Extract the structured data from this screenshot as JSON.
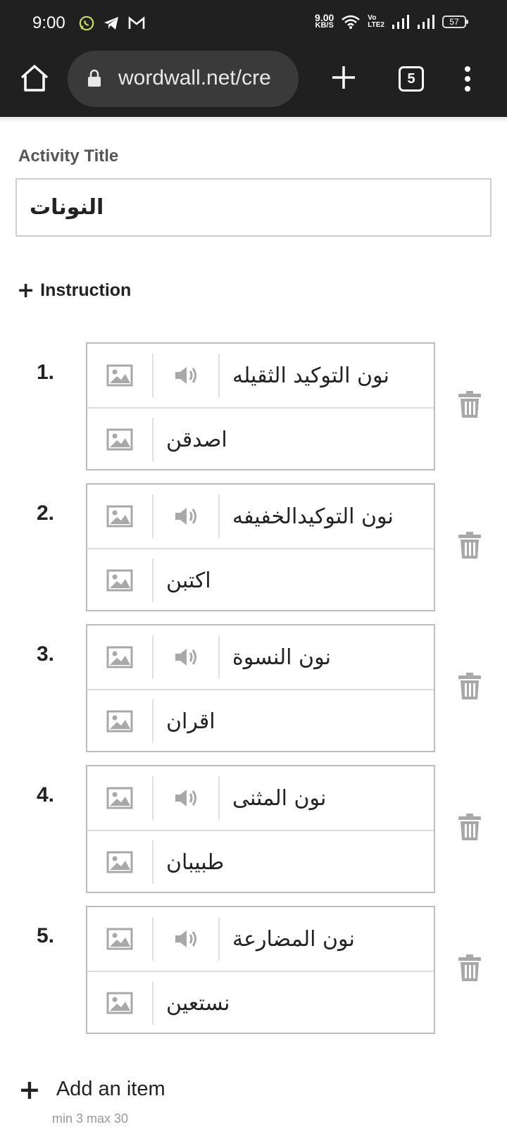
{
  "status_bar": {
    "time": "9:00",
    "net_speed_value": "9.00",
    "net_speed_unit": "KB/S",
    "volte_top": "Vo",
    "volte_bottom": "LTE2",
    "battery": "57"
  },
  "browser": {
    "url": "wordwall.net/cre",
    "tab_count": "5"
  },
  "form": {
    "activity_title_label": "Activity Title",
    "activity_title_value": "النونات",
    "instruction_label": "Instruction",
    "items": [
      {
        "number": "1.",
        "top": "نون التوكيد الثقيله",
        "bottom": "اصدقن"
      },
      {
        "number": "2.",
        "top": "نون التوكيدالخفيفه",
        "bottom": "اكتبن"
      },
      {
        "number": "3.",
        "top": "نون النسوة",
        "bottom": "اقران"
      },
      {
        "number": "4.",
        "top": "نون المثنى",
        "bottom": "طبيبان"
      },
      {
        "number": "5.",
        "top": "نون المضارعة",
        "bottom": "نستعين"
      }
    ],
    "add_item_label": "Add an item",
    "limits": "min 3   max 30"
  },
  "colors": {
    "browser_chrome": "#202020",
    "url_pill": "#3a3a3a",
    "icon_gray": "#a8a8a8",
    "text": "#222222"
  }
}
